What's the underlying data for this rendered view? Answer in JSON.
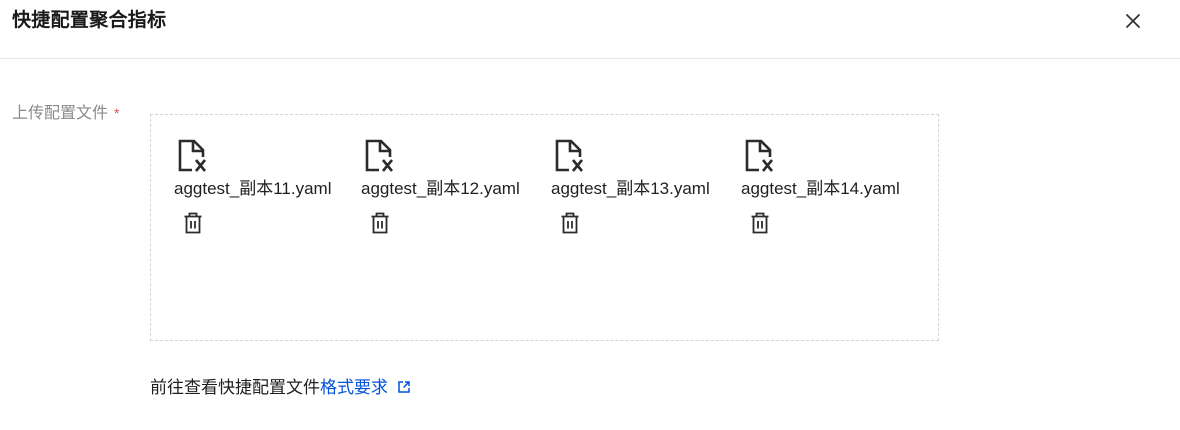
{
  "dialog": {
    "title": "快捷配置聚合指标",
    "close_icon": "close-icon"
  },
  "form": {
    "upload_label": "上传配置文件",
    "required_mark": "*",
    "files": [
      {
        "name": "aggtest_副本11.yaml",
        "status_icon": "file-error-icon",
        "delete_icon": "trash-icon"
      },
      {
        "name": "aggtest_副本12.yaml",
        "status_icon": "file-error-icon",
        "delete_icon": "trash-icon"
      },
      {
        "name": "aggtest_副本13.yaml",
        "status_icon": "file-error-icon",
        "delete_icon": "trash-icon"
      },
      {
        "name": "aggtest_副本14.yaml",
        "status_icon": "file-error-icon",
        "delete_icon": "trash-icon"
      }
    ]
  },
  "hint": {
    "prefix": "前往查看快捷配置文件",
    "link_text": "格式要求",
    "link_icon": "external-link-icon"
  },
  "colors": {
    "link": "#0052d9",
    "required": "#e34d59",
    "label": "#8a8a8a",
    "border": "#d4d4d4"
  }
}
